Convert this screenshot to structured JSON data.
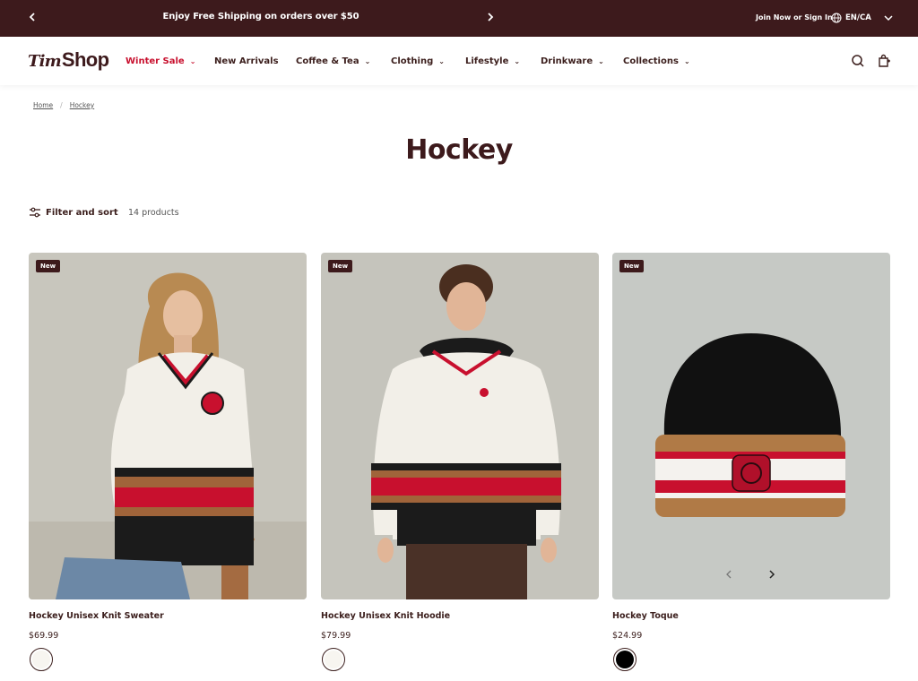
{
  "announcement": {
    "message": "Enjoy Free Shipping on orders over $50",
    "prev_icon": "chevron-left-icon",
    "next_icon": "chevron-right-icon",
    "join_label": "Join Now or Sign In",
    "language_label": "EN/CA"
  },
  "header": {
    "logo_tim": "Tim",
    "logo_shop": "Shop",
    "nav": [
      {
        "label": "Winter Sale",
        "has_dropdown": true,
        "color": "#c8102e"
      },
      {
        "label": "New Arrivals",
        "has_dropdown": false
      },
      {
        "label": "Coffee & Tea",
        "has_dropdown": true
      },
      {
        "label": "Clothing",
        "has_dropdown": true
      },
      {
        "label": "Lifestyle",
        "has_dropdown": true
      },
      {
        "label": "Drinkware",
        "has_dropdown": true
      },
      {
        "label": "Collections",
        "has_dropdown": true
      }
    ],
    "icons": [
      "search-icon",
      "cart-icon"
    ]
  },
  "breadcrumb": {
    "home": "Home",
    "separator": "/",
    "current": "Hockey"
  },
  "page_title": "Hockey",
  "toolbar": {
    "filter_label": "Filter and sort",
    "product_count": "14 products"
  },
  "products": [
    {
      "name": "Hockey Unisex Knit Sweater",
      "price": "$69.99",
      "badge": "New",
      "swatch_color": "#f7f5f0"
    },
    {
      "name": "Hockey Unisex Knit Hoodie",
      "price": "$79.99",
      "badge": "New",
      "swatch_color": "#f7f5f0"
    },
    {
      "name": "Hockey Toque",
      "price": "$24.99",
      "badge": "New",
      "swatch_color": "#000000"
    }
  ],
  "colors": {
    "brand": "#3d1a1c",
    "sale": "#c8102e"
  }
}
